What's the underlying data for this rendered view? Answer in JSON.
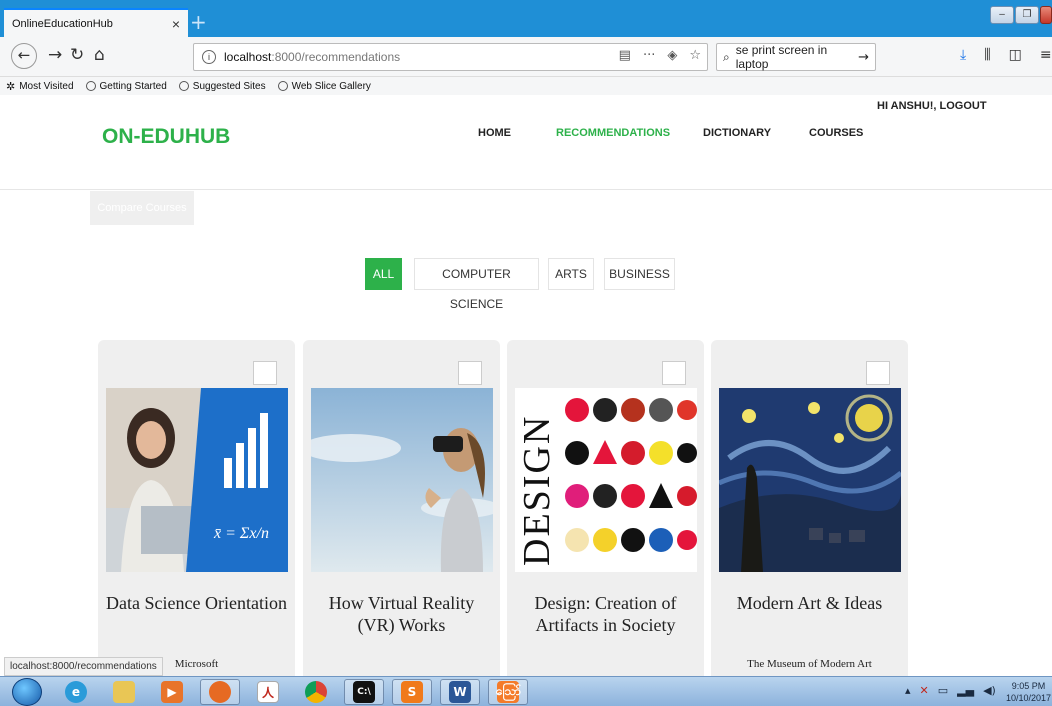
{
  "browser": {
    "tab_title": "OnlineEducationHub",
    "tab_close": "×",
    "new_tab": "+",
    "url_host": "localhost",
    "url_path": ":8000/recommendations",
    "url_info": "i",
    "url_more": "···",
    "search_text": "se print screen in laptop",
    "search_go": "→",
    "bookmarks": [
      "Most Visited",
      "Getting Started",
      "Suggested Sites",
      "Web Slice Gallery"
    ],
    "status_text": "localhost:8000/recommendations"
  },
  "header": {
    "brand": "ON-EDUHUB",
    "greeting": "HI ANSHU!, LOGOUT",
    "nav": [
      "HOME",
      "RECOMMENDATIONS",
      "DICTIONARY",
      "COURSES"
    ],
    "active_nav": "RECOMMENDATIONS",
    "compare_label": "Compare Courses"
  },
  "filters": {
    "items": [
      "ALL",
      "COMPUTER SCIENCE",
      "ARTS",
      "BUSINESS"
    ],
    "active": "ALL"
  },
  "courses": [
    {
      "title": "Data Science Orientation",
      "provider": "Microsoft",
      "image": "woman-with-statistics-tablet"
    },
    {
      "title": "How Virtual Reality (VR) Works",
      "provider": "",
      "image": "woman-wearing-vr-headset"
    },
    {
      "title": "Design: Creation of Artifacts in Society",
      "provider": "",
      "image": "design-colored-symbols"
    },
    {
      "title": "Modern Art & Ideas",
      "provider": "The Museum of Modern Art",
      "image": "starry-night-painting"
    }
  ],
  "taskbar": {
    "apps": [
      "internet-explorer",
      "file-explorer",
      "media-player",
      "firefox",
      "acrobat",
      "chrome",
      "command-prompt",
      "sublime-text",
      "word",
      "xampp"
    ],
    "clock_time": "9:05 PM",
    "clock_date": "10/10/2017"
  },
  "colors": {
    "accent_green": "#2db14a",
    "titlebar_blue": "#1f8fd6"
  }
}
